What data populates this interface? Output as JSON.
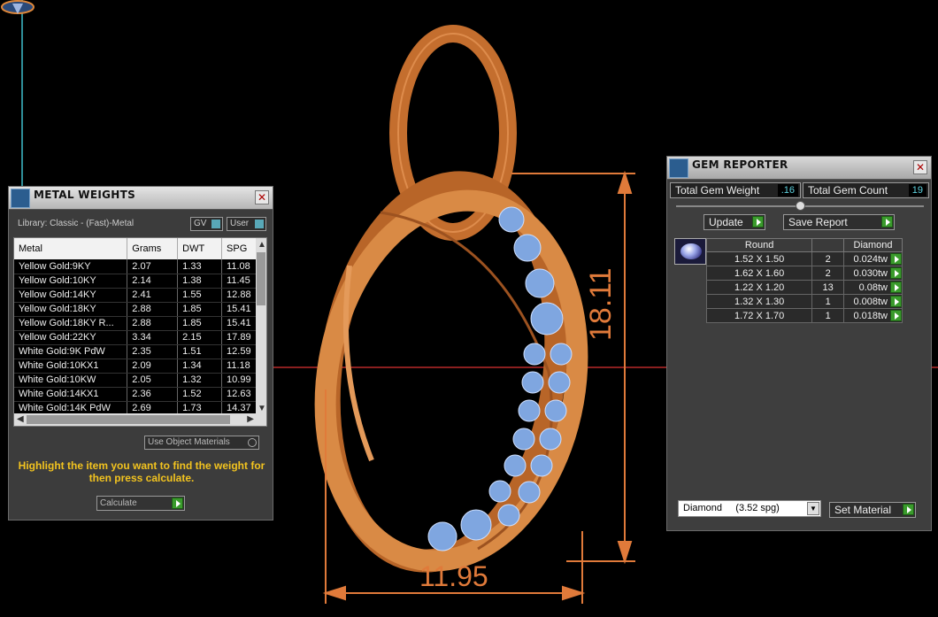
{
  "viewport": {
    "width_dimension": "11.95",
    "height_dimension": "18.11"
  },
  "metal_weights": {
    "title": "METAL WEIGHTS",
    "library": "Library: Classic - (Fast)-Metal",
    "gv_label": "GV",
    "user_label": "User",
    "columns": [
      "Metal",
      "Grams",
      "DWT",
      "SPG"
    ],
    "rows": [
      [
        "Yellow Gold:9KY",
        "2.07",
        "1.33",
        "11.08"
      ],
      [
        "Yellow Gold:10KY",
        "2.14",
        "1.38",
        "11.45"
      ],
      [
        "Yellow Gold:14KY",
        "2.41",
        "1.55",
        "12.88"
      ],
      [
        "Yellow Gold:18KY",
        "2.88",
        "1.85",
        "15.41"
      ],
      [
        "Yellow Gold:18KY R...",
        "2.88",
        "1.85",
        "15.41"
      ],
      [
        "Yellow Gold:22KY",
        "3.34",
        "2.15",
        "17.89"
      ],
      [
        "White Gold:9K PdW",
        "2.35",
        "1.51",
        "12.59"
      ],
      [
        "White Gold:10KX1",
        "2.09",
        "1.34",
        "11.18"
      ],
      [
        "White Gold:10KW",
        "2.05",
        "1.32",
        "10.99"
      ],
      [
        "White Gold:14KX1",
        "2.36",
        "1.52",
        "12.63"
      ],
      [
        "White Gold:14K PdW",
        "2.69",
        "1.73",
        "14.37"
      ]
    ],
    "use_object_materials": "Use Object Materials",
    "message": "Highlight the item you want to find the weight for then press calculate.",
    "calculate_label": "Calculate"
  },
  "gem_reporter": {
    "title": "GEM REPORTER",
    "total_weight_label": "Total Gem Weight",
    "total_weight_value": ".16",
    "total_count_label": "Total Gem Count",
    "total_count_value": "19",
    "update_label": "Update",
    "save_report_label": "Save Report",
    "columns": [
      "Round",
      "",
      "Diamond"
    ],
    "rows": [
      [
        "1.52 X 1.50",
        "2",
        "0.024tw"
      ],
      [
        "1.62 X 1.60",
        "2",
        "0.030tw"
      ],
      [
        "1.22 X 1.20",
        "13",
        "0.08tw"
      ],
      [
        "1.32 X 1.30",
        "1",
        "0.008tw"
      ],
      [
        "1.72 X 1.70",
        "1",
        "0.018tw"
      ]
    ],
    "material_select": "Diamond     (3.52 spg)",
    "set_material_label": "Set Material"
  },
  "colors": {
    "metal": "#d98a45",
    "gem": "#7fa6e0",
    "dimension": "#e07a3a",
    "accent_yellow": "#f2c31f",
    "button_green": "#3a9b2c"
  }
}
